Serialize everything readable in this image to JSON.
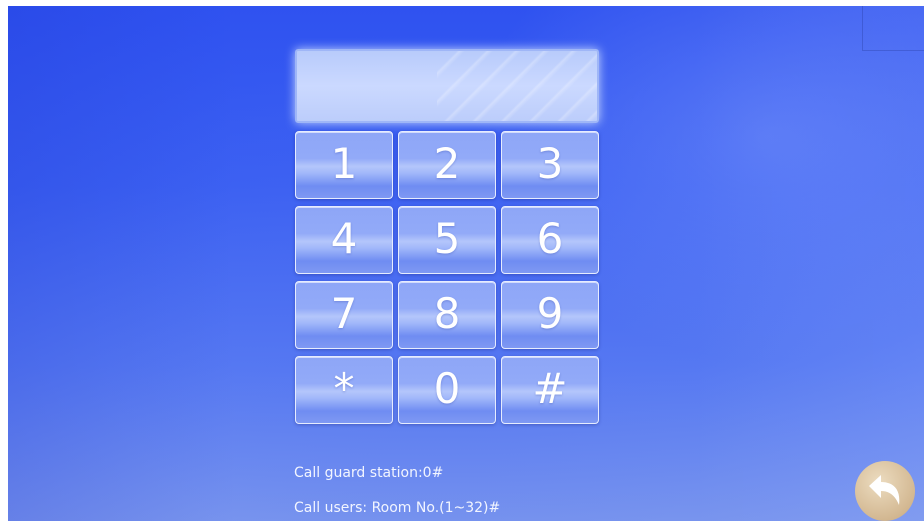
{
  "display": {
    "value": ""
  },
  "keypad": {
    "keys": [
      "1",
      "2",
      "3",
      "4",
      "5",
      "6",
      "7",
      "8",
      "9",
      "*",
      "0",
      "#"
    ]
  },
  "help": {
    "guard_text": "Call guard station:0#",
    "users_text": "Call users: Room No.(1~32)#"
  },
  "back_button": {
    "icon": "back-arrow-icon",
    "color": "#d3b892"
  }
}
